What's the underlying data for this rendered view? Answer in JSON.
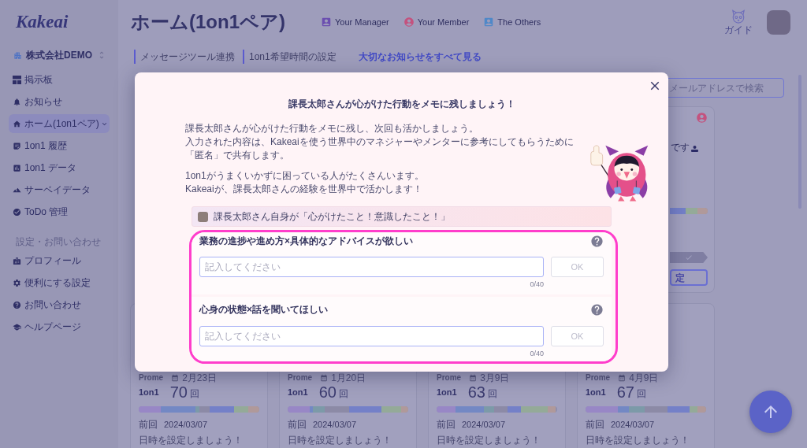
{
  "sidebar": {
    "logo": "Kakeai",
    "company": "株式会社DEMO",
    "items": [
      {
        "label": "掲示板",
        "kind": "link",
        "selected": false
      },
      {
        "label": "お知らせ",
        "kind": "link",
        "selected": false
      },
      {
        "label": "ホーム(1on1ペア)",
        "kind": "group",
        "selected": true
      },
      {
        "label": "1on1 履歴",
        "kind": "link",
        "selected": false
      },
      {
        "label": "1on1 データ",
        "kind": "link",
        "selected": false
      },
      {
        "label": "サーベイデータ",
        "kind": "link",
        "selected": false
      },
      {
        "label": "ToDo 管理",
        "kind": "link",
        "selected": false
      }
    ],
    "settings_heading": "設定・お問い合わせ",
    "settings_items": [
      {
        "label": "プロフィール",
        "kind": "link",
        "selected": false
      },
      {
        "label": "便利にする設定",
        "kind": "link",
        "selected": false
      },
      {
        "label": "お問い合わせ",
        "kind": "link",
        "selected": false
      },
      {
        "label": "ヘルプページ",
        "kind": "link",
        "selected": false
      }
    ]
  },
  "header": {
    "title": "ホーム(1on1ペア)",
    "legend": [
      {
        "label": "Your Manager",
        "kind": "box",
        "color": "#6b4fb0"
      },
      {
        "label": "Your Member",
        "kind": "circle",
        "color": "#c4527e"
      },
      {
        "label": "The Others",
        "kind": "box",
        "color": "#4f88c8"
      }
    ],
    "guide": "ガイド"
  },
  "subnav": {
    "items": [
      "メッセージツール連携",
      "1on1希望時間の設定"
    ],
    "link": "大切なお知らせをすべて見る"
  },
  "search": {
    "placeholder": "メールアドレスで検索"
  },
  "top_card": {
    "text": "です",
    "button": "定"
  },
  "cards": [
    {
      "source": "Prome",
      "date": "2月23日",
      "label": "1on1",
      "count": "70",
      "unit": "回",
      "previous_label": "前回",
      "previous_date": "2024/03/07",
      "prompt": "日時を設定しましょう！"
    },
    {
      "source": "Prome",
      "date": "1月20日",
      "label": "1on1",
      "count": "60",
      "unit": "回",
      "previous_label": "前回",
      "previous_date": "2024/03/07",
      "prompt": "日時を設定しましょう！"
    },
    {
      "source": "Prome",
      "date": "3月9日",
      "label": "1on1",
      "count": "63",
      "unit": "回",
      "previous_label": "前回",
      "previous_date": "2024/03/07",
      "prompt": "日時を設定しましょう！"
    },
    {
      "source": "Prome",
      "date": "4月9日",
      "label": "1on1",
      "count": "67",
      "unit": "回",
      "previous_label": "前回",
      "previous_date": "2024/03/07",
      "prompt": "日時を設定しましょう！"
    }
  ],
  "dialog": {
    "title": "課長太郎さんが心がけた行動をメモに残しましょう！",
    "paragraphs": [
      [
        "課長太郎さんが心がけた行動をメモに残し、次回も活かしましょう。",
        "入力された内容は、Kakeaiを使う世界中のマネジャーやメンターに参考にしてもらうために",
        "「匿名」で共有します。"
      ],
      [
        "1on1がうまくいかずに困っている人がたくさんいます。",
        "Kakeaiが、課長太郎さんの経験を世界中で活かします！"
      ]
    ],
    "banner": "課長太郎さん自身が「心がけたこと！意識したこと！」",
    "questions": [
      {
        "title": "業務の進捗や進め方×具体的なアドバイスが欲しい",
        "placeholder": "記入してください",
        "button": {
          "label": "OK",
          "disabled": true
        },
        "counter": "0/40"
      },
      {
        "title": "心身の状態×話を聞いてほしい",
        "placeholder": "記入してください",
        "button": {
          "label": "OK",
          "disabled": true
        },
        "counter": "0/40"
      }
    ]
  }
}
